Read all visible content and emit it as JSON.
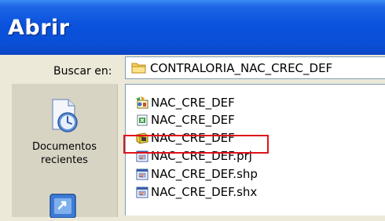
{
  "window": {
    "title": "Abrir"
  },
  "look_in": {
    "label": "Buscar en:",
    "value": "CONTRALORIA_NAC_CREC_DEF",
    "icon": "folder-icon"
  },
  "places": [
    {
      "label_line1": "Documentos",
      "label_line2": "recientes",
      "icon": "recent-documents-icon"
    },
    {
      "label_line1": "",
      "label_line2": "",
      "icon": "desktop-icon"
    }
  ],
  "files": [
    {
      "name": "NAC_CRE_DEF",
      "icon": "map-project-icon"
    },
    {
      "name": "NAC_CRE_DEF",
      "icon": "spreadsheet-icon"
    },
    {
      "name": "NAC_CRE_DEF",
      "icon": "shapefile-icon",
      "highlighted": true
    },
    {
      "name": "NAC_CRE_DEF.prj",
      "icon": "system-file-icon"
    },
    {
      "name": "NAC_CRE_DEF.shp",
      "icon": "system-file-icon"
    },
    {
      "name": "NAC_CRE_DEF.shx",
      "icon": "system-file-icon"
    }
  ],
  "colors": {
    "titlebar": "#0a52dc",
    "highlight": "#e0131a",
    "dialog_bg": "#ece9d8"
  }
}
